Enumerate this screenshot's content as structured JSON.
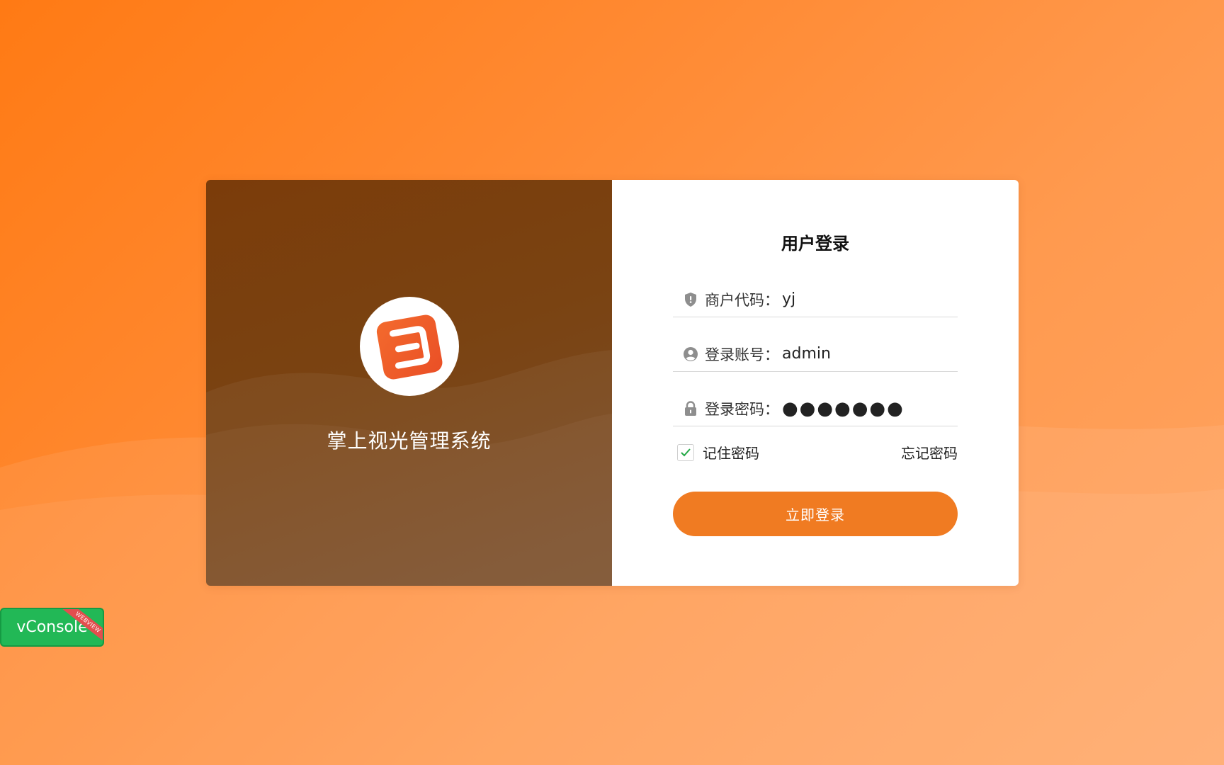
{
  "brand": {
    "app_name": "掌上视光管理系统",
    "logo_icon": "document-logo-icon",
    "logo_color": "#ef5a2a"
  },
  "login": {
    "title": "用户登录",
    "fields": [
      {
        "icon": "shield-icon",
        "label": "商户代码：",
        "value": "yj"
      },
      {
        "icon": "user-icon",
        "label": "登录账号：",
        "value": "admin"
      },
      {
        "icon": "lock-icon",
        "label": "登录密码：",
        "value": "●●●●●●●"
      }
    ],
    "remember_label": "记住密码",
    "remember_checked": true,
    "forgot_label": "忘记密码",
    "submit_label": "立即登录"
  },
  "vconsole": {
    "label": "vConsole",
    "ribbon": "WEBVIEW"
  },
  "colors": {
    "accent": "#f07b22",
    "brand_panel": "#7a4312",
    "vconsole": "#22b856"
  }
}
